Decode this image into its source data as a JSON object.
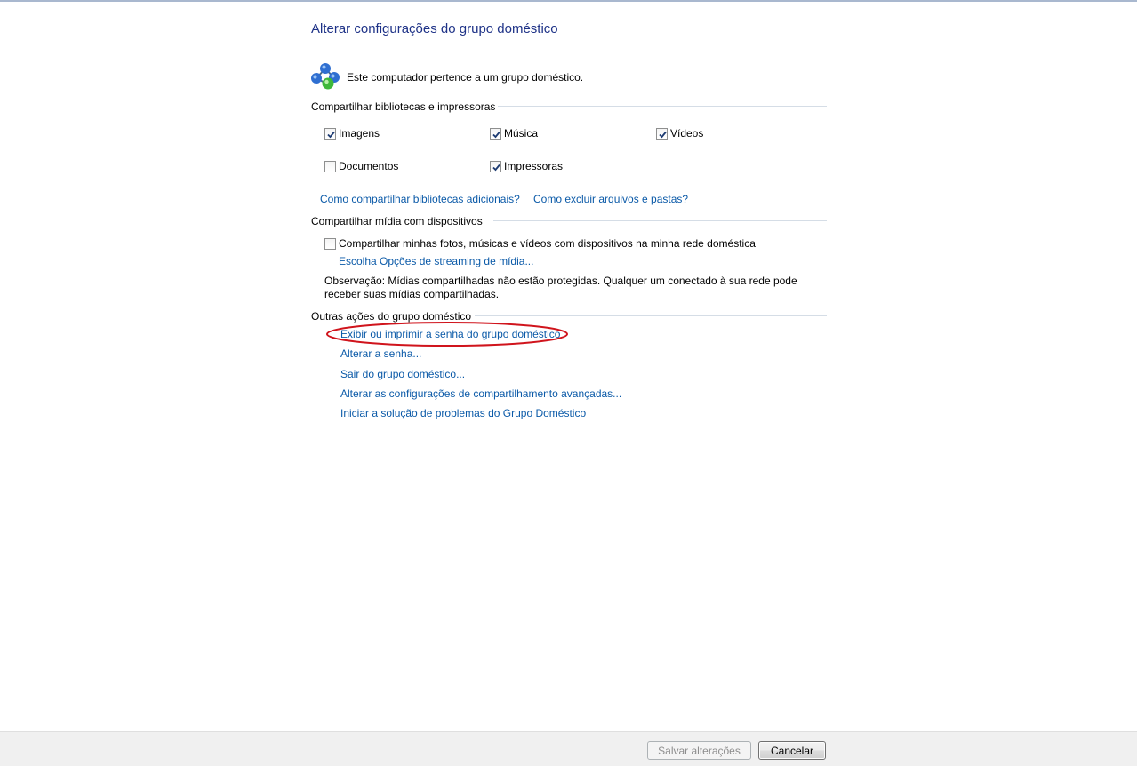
{
  "title": "Alterar configurações do grupo doméstico",
  "status": {
    "icon": "homegroup-icon",
    "text": "Este computador pertence a um grupo doméstico."
  },
  "libraries": {
    "heading": "Compartilhar bibliotecas e impressoras",
    "items": [
      {
        "label": "Imagens",
        "checked": true
      },
      {
        "label": "Música",
        "checked": true
      },
      {
        "label": "Vídeos",
        "checked": true
      },
      {
        "label": "Documentos",
        "checked": false
      },
      {
        "label": "Impressoras",
        "checked": true
      }
    ],
    "link_additional": "Como compartilhar bibliotecas adicionais?",
    "link_exclude": "Como excluir arquivos e pastas?"
  },
  "media": {
    "heading": "Compartilhar mídia com dispositivos",
    "share_label": "Compartilhar minhas fotos, músicas e vídeos com dispositivos na minha rede doméstica",
    "share_checked": false,
    "streaming_link": "Escolha Opções de streaming de mídia...",
    "note": "Observação: Mídias compartilhadas não estão protegidas. Qualquer um conectado à sua rede pode receber suas mídias compartilhadas."
  },
  "other": {
    "heading": "Outras ações do grupo doméstico",
    "actions": [
      "Exibir ou imprimir a senha do grupo doméstico",
      "Alterar a senha...",
      "Sair do grupo doméstico...",
      "Alterar as configurações de compartilhamento avançadas...",
      "Iniciar a solução de problemas do Grupo Doméstico"
    ]
  },
  "footer": {
    "save_label": "Salvar alterações",
    "save_enabled": false,
    "cancel_label": "Cancelar"
  },
  "colors": {
    "title": "#1e3287",
    "link": "#0b5aa8",
    "annotation": "#d0141c"
  }
}
